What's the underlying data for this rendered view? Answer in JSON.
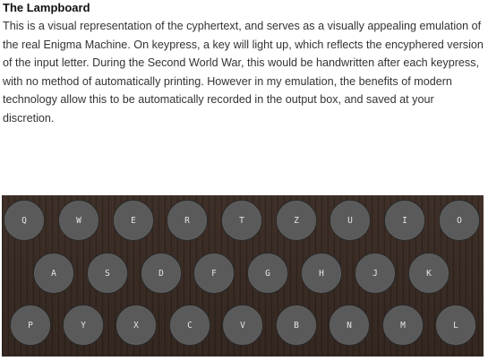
{
  "section": {
    "title": "The Lampboard",
    "description": "This is a visual representation of the cyphertext, and serves as a visually appealing emulation of the real Enigma Machine. On keypress, a key will light up, which reflects the encyphered version of the input letter. During the Second World War, this would be handwritten after each keypress, with no method of automatically printing. However in my emulation, the benefits of modern technology allow this to be automatically recorded in the output box, and saved at your discretion."
  },
  "lampboard": {
    "rows": [
      [
        "Q",
        "W",
        "E",
        "R",
        "T",
        "Z",
        "U",
        "I",
        "O"
      ],
      [
        "A",
        "S",
        "D",
        "F",
        "G",
        "H",
        "J",
        "K"
      ],
      [
        "P",
        "Y",
        "X",
        "C",
        "V",
        "B",
        "N",
        "M",
        "L"
      ]
    ]
  }
}
